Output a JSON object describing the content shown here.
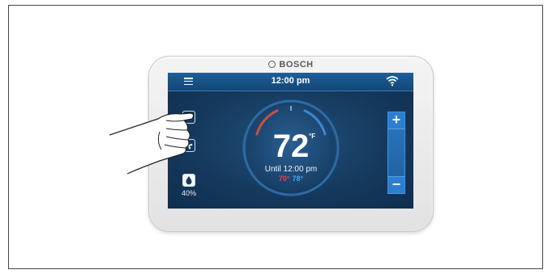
{
  "device": {
    "brand": "BOSCH"
  },
  "screen": {
    "time": "12:00 pm",
    "setpoint": "72",
    "unit": "°F",
    "until": "Until 12:00 pm",
    "heat_setpoint": "70°",
    "cool_setpoint": "78°",
    "humidity": "40%",
    "increase_label": "+",
    "decrease_label": "−"
  },
  "icons": {
    "menu": "menu-icon",
    "wifi": "wifi-icon",
    "mode": "mode-icon",
    "fan": "fan-icon",
    "humidity": "water-drop-icon"
  },
  "colors": {
    "screen_bg": "#153a5e",
    "heat": "#e84545",
    "cool": "#4aa6f0",
    "accent": "#2a7fd0"
  }
}
